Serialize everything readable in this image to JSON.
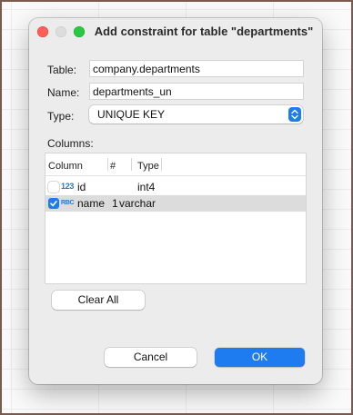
{
  "dialog": {
    "title": "Add constraint for table \"departments\""
  },
  "form": {
    "table_label": "Table:",
    "table_value": "company.departments",
    "name_label": "Name:",
    "name_value": "departments_un",
    "type_label": "Type:",
    "type_value": "UNIQUE KEY",
    "columns_label": "Columns:"
  },
  "columns_table": {
    "headers": {
      "column": "Column",
      "number": "#",
      "type": "Type"
    },
    "rows": [
      {
        "checked": false,
        "type_icon": "123",
        "name": "id",
        "number": "",
        "type": "int4"
      },
      {
        "checked": true,
        "type_icon": "RBC",
        "name": "name",
        "number": "1",
        "type": "varchar"
      }
    ]
  },
  "buttons": {
    "clear_all": "Clear All",
    "cancel": "Cancel",
    "ok": "OK"
  },
  "colors": {
    "accent": "#1f7cf0",
    "close_light": "#ff5f57",
    "zoom_light": "#28c840"
  }
}
